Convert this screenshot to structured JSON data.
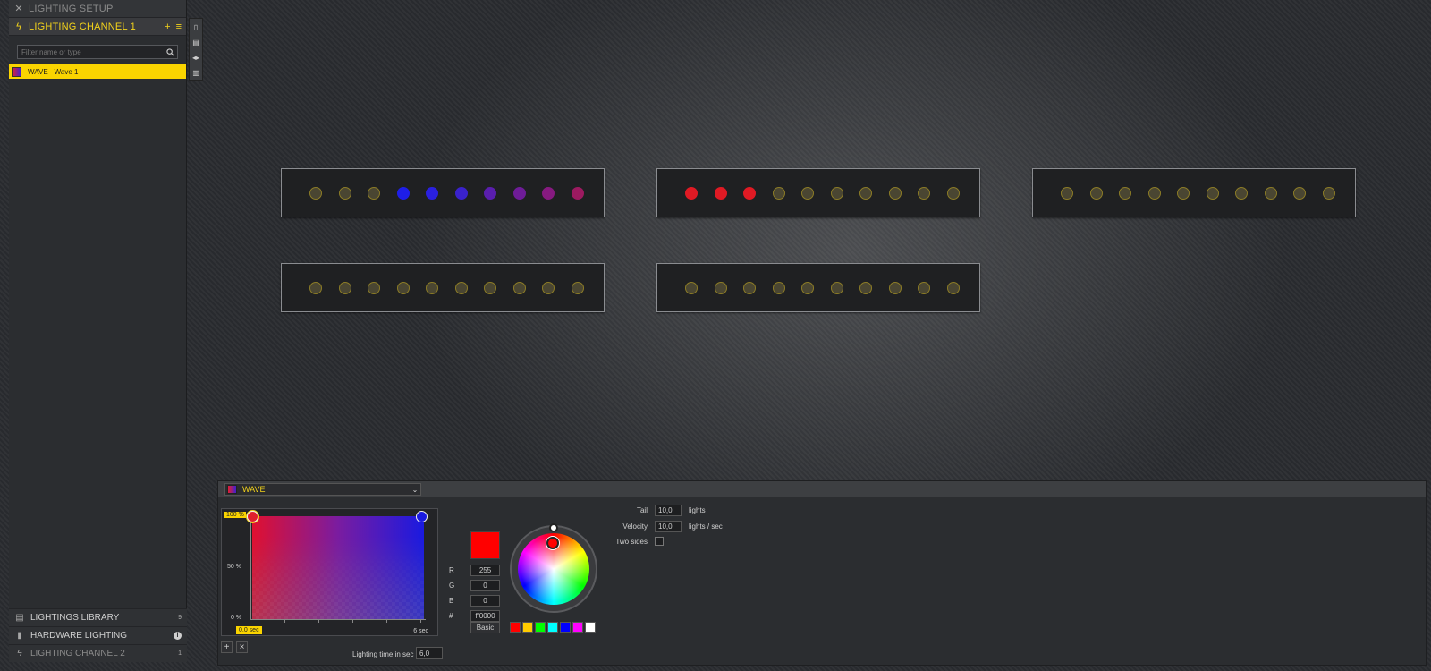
{
  "sidebar": {
    "header_setup": "LIGHTING SETUP",
    "header_channel": "LIGHTING CHANNEL 1",
    "filter_placeholder": "Filter name or type",
    "layer": {
      "type": "WAVE",
      "name": "Wave 1"
    },
    "bottom": [
      {
        "label": "LIGHTINGS LIBRARY",
        "badge": "9",
        "icon": "library-icon"
      },
      {
        "label": "HARDWARE LIGHTING",
        "icon": "hardware-icon"
      },
      {
        "label": "LIGHTING CHANNEL 2",
        "badge": "1",
        "icon": "lightning-icon"
      }
    ]
  },
  "strips": [
    {
      "leds": [
        "#4a4632",
        "#4a4632",
        "#4a4632",
        "#1e1ee8",
        "#2a20e0",
        "#3a22cc",
        "#5a1eae",
        "#6e1c98",
        "#861a80",
        "#9c1a60"
      ]
    },
    {
      "leds": [
        "#e01a24",
        "#e01a24",
        "#e01a24",
        "#4a4632",
        "#4a4632",
        "#4a4632",
        "#4a4632",
        "#4a4632",
        "#4a4632",
        "#4a4632"
      ]
    },
    {
      "leds": [
        "#4a4632",
        "#4a4632",
        "#4a4632",
        "#4a4632",
        "#4a4632",
        "#4a4632",
        "#4a4632",
        "#4a4632",
        "#4a4632",
        "#4a4632"
      ]
    },
    {
      "leds": [
        "#4a4632",
        "#4a4632",
        "#4a4632",
        "#4a4632",
        "#4a4632",
        "#4a4632",
        "#4a4632",
        "#4a4632",
        "#4a4632",
        "#4a4632"
      ]
    },
    {
      "leds": [
        "#4a4632",
        "#4a4632",
        "#4a4632",
        "#4a4632",
        "#4a4632",
        "#4a4632",
        "#4a4632",
        "#4a4632",
        "#4a4632",
        "#4a4632"
      ]
    }
  ],
  "editor": {
    "effect_name": "WAVE",
    "y_labels": {
      "top": "100 %",
      "mid": "50 %",
      "bottom": "0 %"
    },
    "time_start": "0.0 sec",
    "time_end": "6 sec",
    "lighting_time_label": "Lighting time in sec",
    "lighting_time_value": "6,0",
    "color": {
      "r": "255",
      "g": "0",
      "b": "0",
      "hex": "ff0000",
      "r_label": "R",
      "g_label": "G",
      "b_label": "B",
      "hex_label": "#",
      "basic_label": "Basic",
      "presets": [
        "#ff0000",
        "#ffcc00",
        "#00ff00",
        "#00ffff",
        "#0000ff",
        "#ff00ff",
        "#ffffff"
      ]
    },
    "params": {
      "tail_label": "Tail",
      "tail_value": "10,0",
      "tail_unit": "lights",
      "velocity_label": "Velocity",
      "velocity_value": "10,0",
      "velocity_unit": "lights / sec",
      "two_sides_label": "Two sides"
    }
  }
}
